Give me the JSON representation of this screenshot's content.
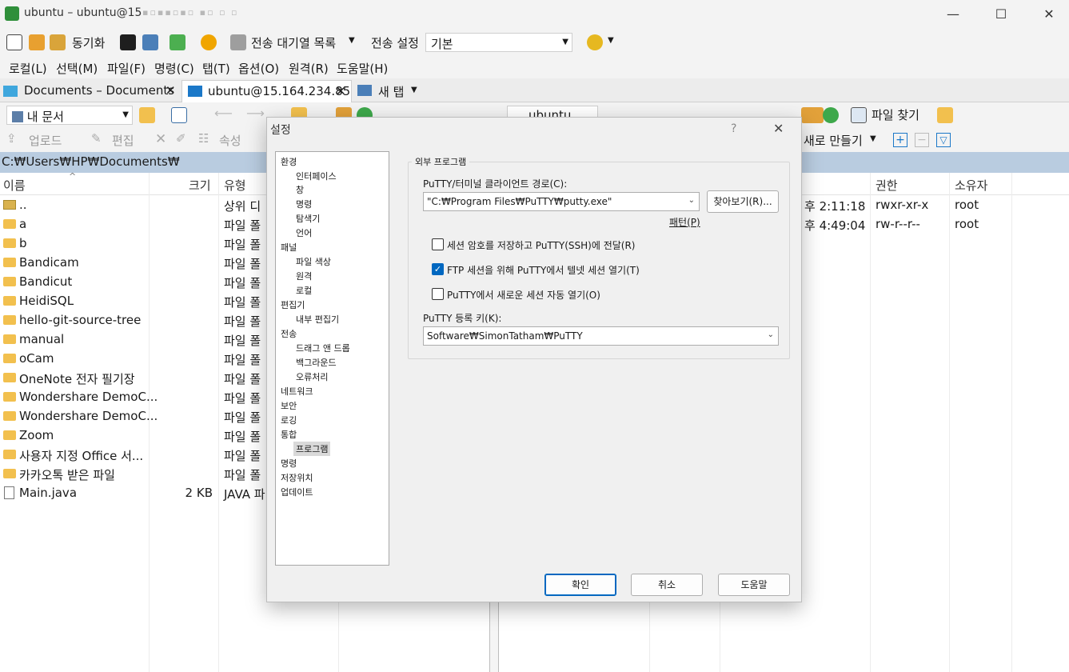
{
  "window": {
    "title": "ubuntu – ubuntu@15",
    "blurred": "▪▫▪▪▫▪▫  ▪▫ ▫  ▫",
    "minimize": "—",
    "maximize": "☐",
    "close": "✕"
  },
  "toolbar": {
    "sync_label": "동기화",
    "queue_label": "전송 대기열 목록",
    "transfer_settings_label": "전송 설정",
    "transfer_preset": "기본"
  },
  "menu": [
    "로컬(L)",
    "선택(M)",
    "파일(F)",
    "명령(C)",
    "탭(T)",
    "옵션(O)",
    "원격(R)",
    "도움말(H)"
  ],
  "tabs": [
    {
      "label": "Documents – Documents"
    },
    {
      "label": "ubuntu@15.164.234.85"
    },
    {
      "label": "새 탭"
    }
  ],
  "local_panel": {
    "location": "내 문서",
    "upload_label": "업로드",
    "edit_label": "편집",
    "properties_label": "속성",
    "path": "C:₩Users₩HP₩Documents₩",
    "columns": {
      "name": "이름",
      "size": "크기",
      "type": "유형"
    },
    "files": [
      {
        "name": "..",
        "size": "",
        "type": "상위 디"
      },
      {
        "name": "a",
        "size": "",
        "type": "파일 폴"
      },
      {
        "name": "b",
        "size": "",
        "type": "파일 폴"
      },
      {
        "name": "Bandicam",
        "size": "",
        "type": "파일 폴"
      },
      {
        "name": "Bandicut",
        "size": "",
        "type": "파일 폴"
      },
      {
        "name": "HeidiSQL",
        "size": "",
        "type": "파일 폴"
      },
      {
        "name": "hello-git-source-tree",
        "size": "",
        "type": "파일 폴"
      },
      {
        "name": "manual",
        "size": "",
        "type": "파일 폴"
      },
      {
        "name": "oCam",
        "size": "",
        "type": "파일 폴"
      },
      {
        "name": "OneNote 전자 필기장",
        "size": "",
        "type": "파일 폴"
      },
      {
        "name": "Wondershare DemoC...",
        "size": "",
        "type": "파일 폴"
      },
      {
        "name": "Wondershare DemoC...",
        "size": "",
        "type": "파일 폴"
      },
      {
        "name": "Zoom",
        "size": "",
        "type": "파일 폴"
      },
      {
        "name": "사용자 지정 Office 서...",
        "size": "",
        "type": "파일 폴"
      },
      {
        "name": "카카오톡 받은 파일",
        "size": "",
        "type": "파일 폴"
      },
      {
        "name": "Main.java",
        "size": "2 KB",
        "type": "JAVA 파"
      }
    ]
  },
  "remote_panel": {
    "location": "ubuntu",
    "find_files_label": "파일 찾기",
    "new_label": "새로 만들기",
    "columns": {
      "rights": "권한",
      "owner": "소유자"
    },
    "rows": [
      {
        "time": "후 2:11:18",
        "rights": "rwxr-xr-x",
        "owner": "root"
      },
      {
        "time": "후 4:49:04",
        "rights": "rw-r--r--",
        "owner": "root"
      }
    ]
  },
  "dialog": {
    "title": "설정",
    "help_glyph": "?",
    "close_glyph": "✕",
    "tree": [
      {
        "label": "환경",
        "level": 0
      },
      {
        "label": "인터페이스",
        "level": 1
      },
      {
        "label": "창",
        "level": 1
      },
      {
        "label": "명령",
        "level": 1
      },
      {
        "label": "탐색기",
        "level": 1
      },
      {
        "label": "언어",
        "level": 1
      },
      {
        "label": "패널",
        "level": 0
      },
      {
        "label": "파일 색상",
        "level": 1
      },
      {
        "label": "원격",
        "level": 1
      },
      {
        "label": "로컬",
        "level": 1
      },
      {
        "label": "편집기",
        "level": 0
      },
      {
        "label": "내부 편집기",
        "level": 1
      },
      {
        "label": "전송",
        "level": 0
      },
      {
        "label": "드래그 앤 드롭",
        "level": 1
      },
      {
        "label": "백그라운드",
        "level": 1
      },
      {
        "label": "오류처리",
        "level": 1
      },
      {
        "label": "네트워크",
        "level": 0
      },
      {
        "label": "보안",
        "level": 0
      },
      {
        "label": "로깅",
        "level": 0
      },
      {
        "label": "통합",
        "level": 0
      },
      {
        "label": "프로그램",
        "level": 1,
        "selected": true
      },
      {
        "label": "명령",
        "level": 0
      },
      {
        "label": "저장위치",
        "level": 0
      },
      {
        "label": "업데이트",
        "level": 0
      }
    ],
    "group_title": "외부 프로그램",
    "putty_path_label": "PuTTY/터미널 클라이언트 경로(C):",
    "putty_path_value": "\"C:₩Program Files₩PuTTY₩putty.exe\"",
    "browse_label": "찾아보기(R)...",
    "pattern_label": "패턴(P)",
    "checkboxes": [
      {
        "label": "세션 암호를 저장하고 PuTTY(SSH)에 전달(R)",
        "checked": false
      },
      {
        "label": "FTP 세션을 위해 PuTTY에서 텔넷 세션 열기(T)",
        "checked": true
      },
      {
        "label": "PuTTY에서 새로운 세션 자동 열기(O)",
        "checked": false
      }
    ],
    "registry_label": "PuTTY 등록 키(K):",
    "registry_value": "Software₩SimonTatham₩PuTTY",
    "ok_label": "확인",
    "cancel_label": "취소",
    "help_label": "도움말",
    "check_glyph": "✓"
  },
  "colors": {
    "accent": "#0067c0",
    "path_bar": "#b9cce0",
    "folder": "#f2c04e"
  }
}
